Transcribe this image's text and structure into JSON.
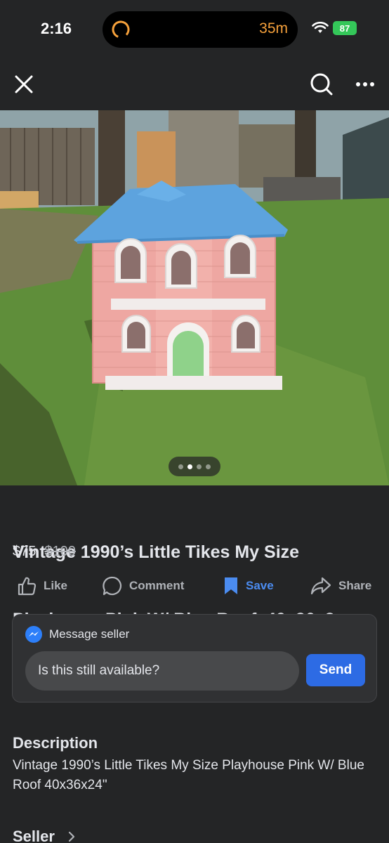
{
  "status_bar": {
    "time": "2:16",
    "timer": "35m",
    "battery": "87"
  },
  "nav": {
    "close_icon": "close-icon",
    "search_icon": "search-icon",
    "more_icon": "more-icon"
  },
  "photo": {
    "page_count": 4,
    "active_page": 2
  },
  "listing": {
    "title_line1": "Vintage 1990’s Little Tikes My Size",
    "title_line2": "Playhouse Pink W/ Blue Roof  40x36x2…",
    "price": "$75",
    "original_price": "$100"
  },
  "actions": {
    "like": "Like",
    "comment": "Comment",
    "save": "Save",
    "share": "Share"
  },
  "message": {
    "header": "Message seller",
    "input_value": "Is this still available?",
    "send": "Send"
  },
  "description": {
    "heading": "Description",
    "text": "Vintage 1990’s Little Tikes My Size Playhouse Pink W/ Blue Roof  40x36x24\""
  },
  "seller": {
    "heading": "Seller"
  },
  "colors": {
    "background": "#242526",
    "accent": "#2d6be4",
    "save_blue": "#4b8cf0"
  }
}
